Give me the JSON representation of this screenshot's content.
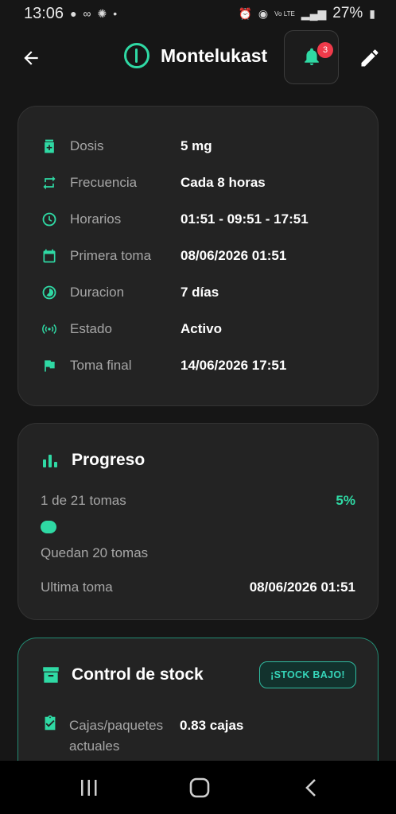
{
  "status_bar": {
    "time": "13:06",
    "battery": "27%",
    "network": "Vo LTE"
  },
  "header": {
    "title": "Montelukast",
    "notification_count": "3"
  },
  "details": {
    "rows": [
      {
        "label": "Dosis",
        "value": "5 mg",
        "icon": "pill-box-icon"
      },
      {
        "label": "Frecuencia",
        "value": "Cada 8 horas",
        "icon": "repeat-icon"
      },
      {
        "label": "Horarios",
        "value": "01:51 - 09:51 - 17:51",
        "icon": "clock-icon"
      },
      {
        "label": "Primera toma",
        "value": "08/06/2026 01:51",
        "icon": "calendar-icon"
      },
      {
        "label": "Duracion",
        "value": "7 días",
        "icon": "timelapse-icon"
      },
      {
        "label": "Estado",
        "value": "Activo",
        "icon": "broadcast-icon"
      },
      {
        "label": "Toma final",
        "value": "14/06/2026 17:51",
        "icon": "flag-icon"
      }
    ]
  },
  "progress": {
    "title": "Progreso",
    "count_text": "1 de 21 tomas",
    "percent_text": "5%",
    "fraction": 0.05,
    "remaining_text": "Quedan 20 tomas",
    "last_label": "Ultima toma",
    "last_value": "08/06/2026 01:51"
  },
  "stock": {
    "title": "Control de stock",
    "badge": "¡STOCK BAJO!",
    "label": "Cajas/paquetes actuales",
    "value": "0.83 cajas"
  },
  "colors": {
    "accent": "#2fd9a4",
    "background": "#161616",
    "card": "#232323",
    "badge": "#ef3a4a"
  }
}
